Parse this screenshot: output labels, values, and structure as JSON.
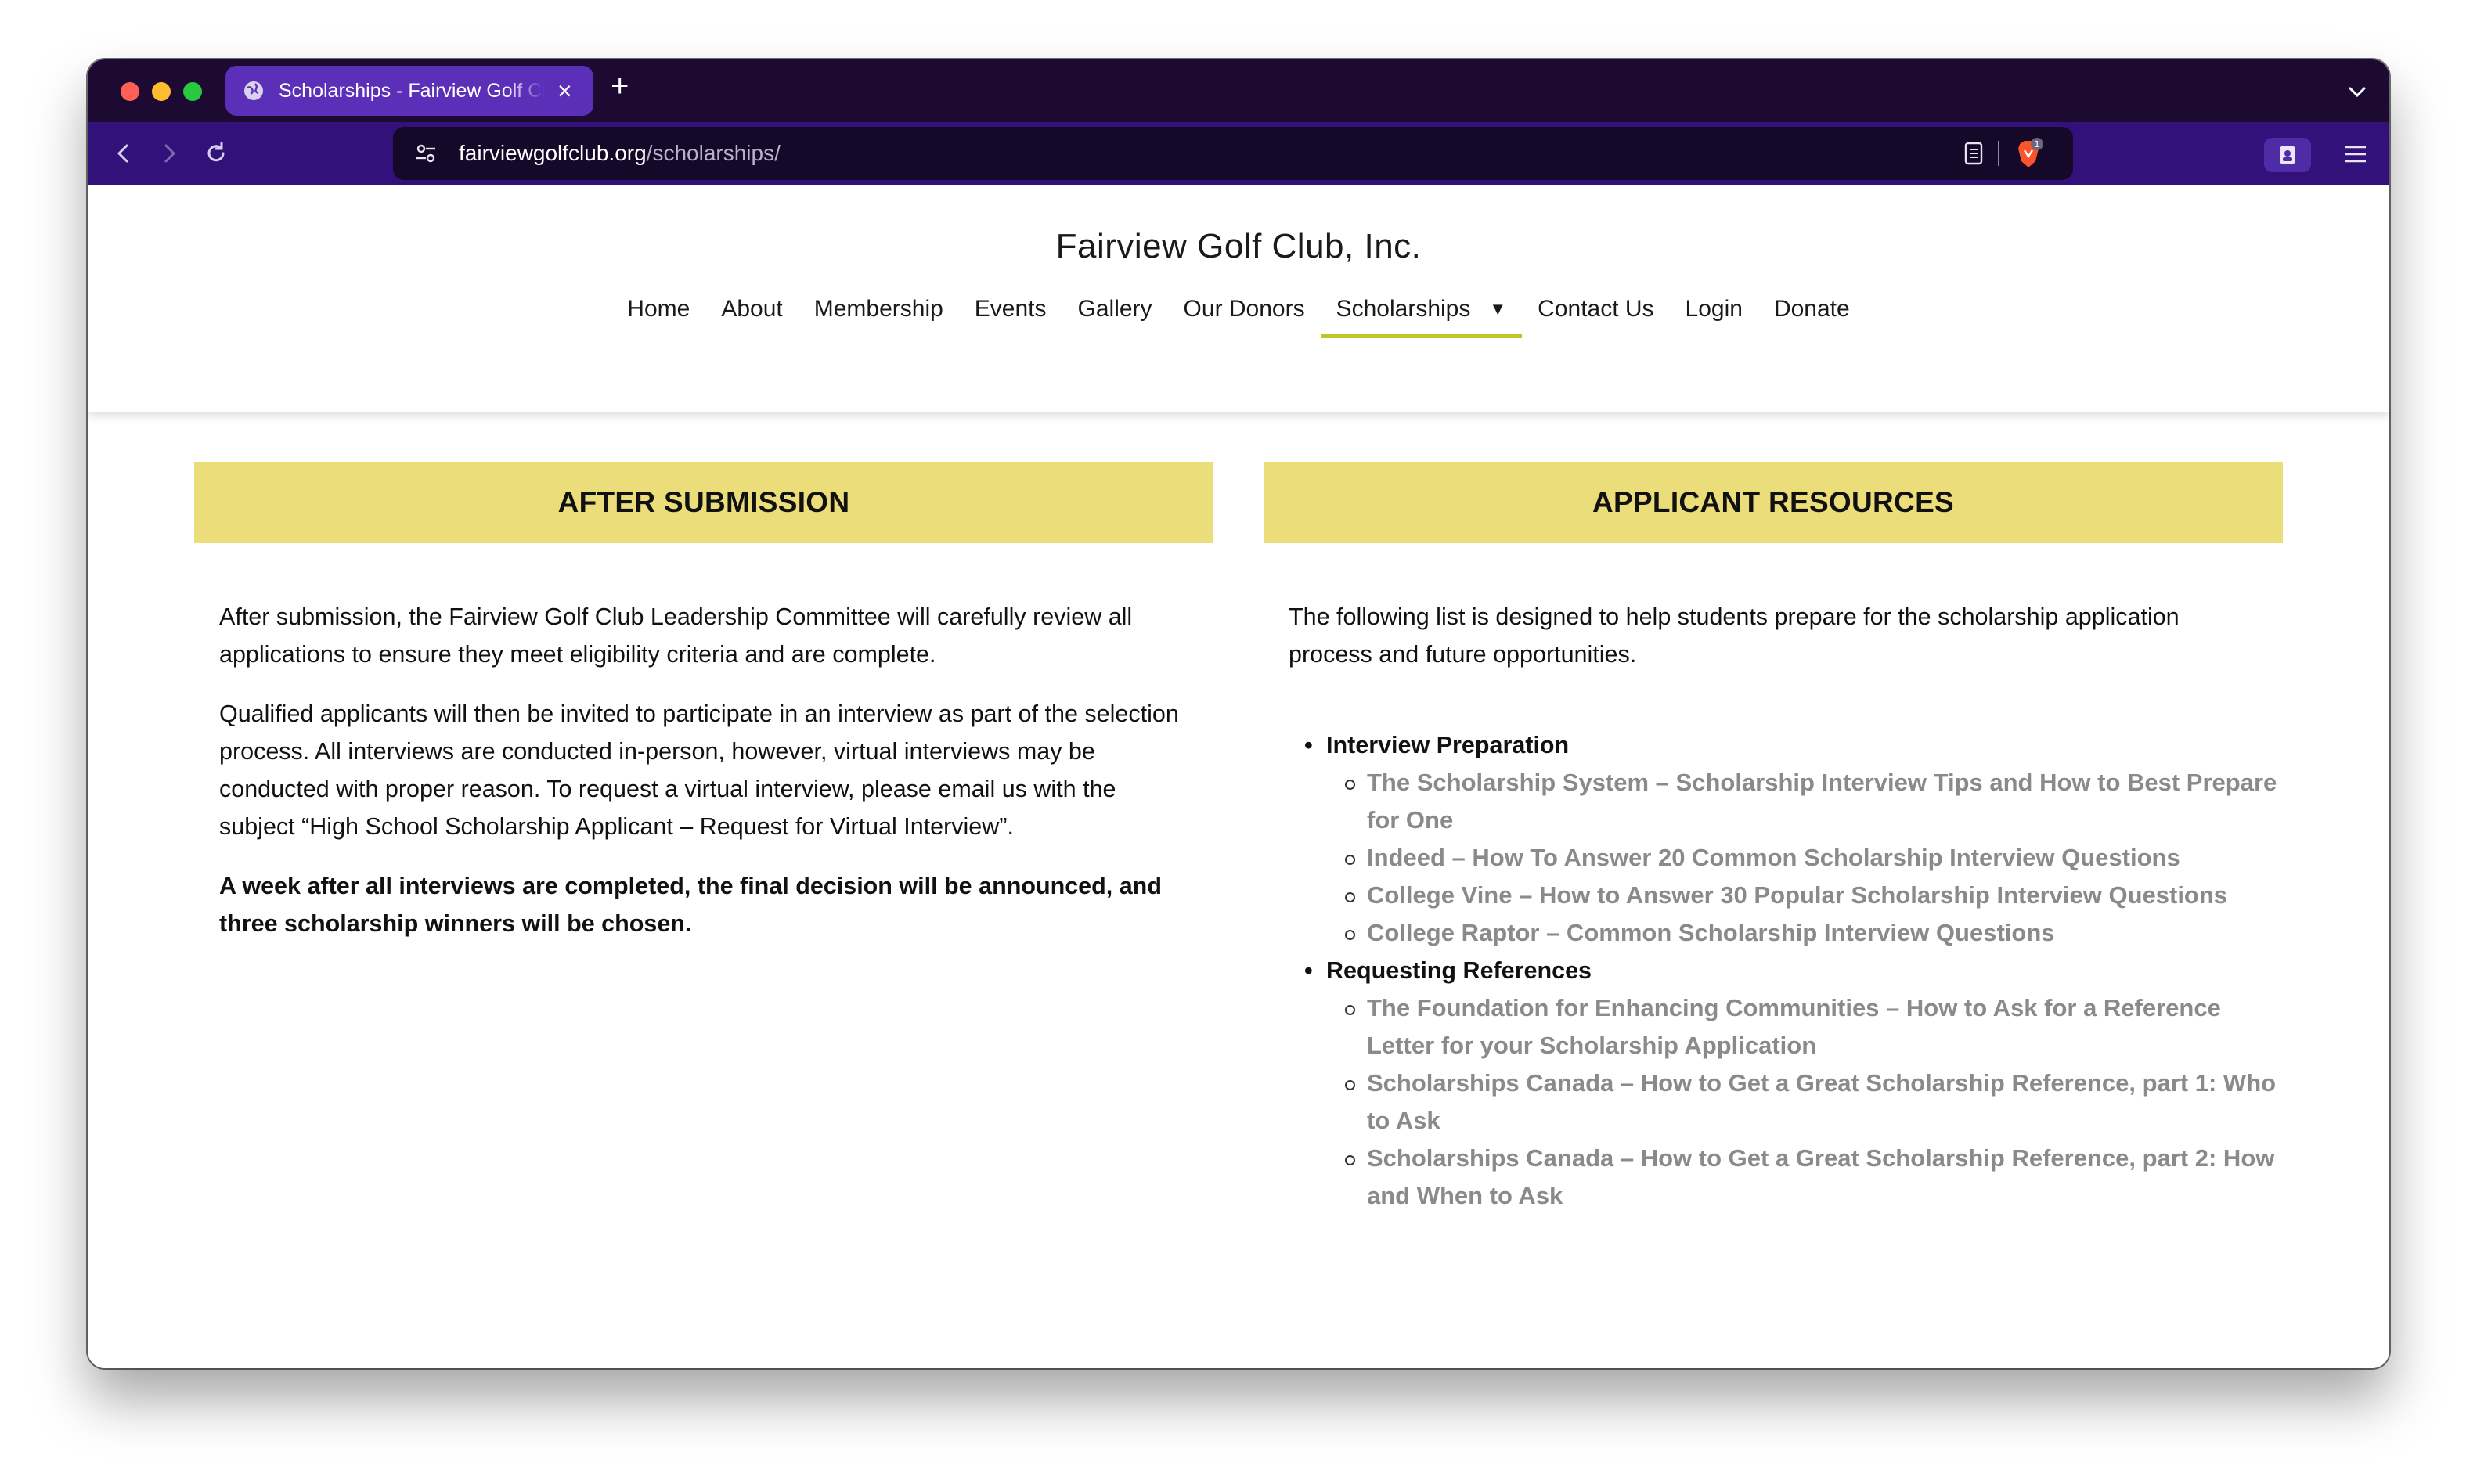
{
  "browser": {
    "tab_title": "Scholarships - Fairview Golf Club, Inc.",
    "url_host": "fairviewgolfclub.org",
    "url_path": "/scholarships/",
    "brave_badge": "1",
    "colors": {
      "tabstrip": "#1c0a33",
      "toolbar": "#32127a",
      "tab_active": "#5b2fb8"
    }
  },
  "site": {
    "title": "Fairview Golf Club, Inc.",
    "nav": [
      {
        "label": "Home"
      },
      {
        "label": "About"
      },
      {
        "label": "Membership"
      },
      {
        "label": "Events"
      },
      {
        "label": "Gallery"
      },
      {
        "label": "Our Donors"
      },
      {
        "label": "Scholarships",
        "active": true
      },
      {
        "label": "Contact Us"
      },
      {
        "label": "Login"
      },
      {
        "label": "Donate"
      }
    ],
    "accent_color": "#c3c22a",
    "banner_color": "#ebdd7a"
  },
  "after_submission": {
    "heading": "AFTER SUBMISSION",
    "p1": "After submission, the Fairview Golf Club Leadership Committee will carefully review all applications to ensure they meet eligibility criteria and are complete.",
    "p2": "Qualified applicants will then be invited to participate in an interview as part of the selection process. All interviews are conducted in-person, however, virtual interviews may be conducted with proper reason. To request a virtual interview, please email us with the subject “High School Scholarship Applicant – Request for Virtual Interview”.",
    "p3": "A week after all interviews are completed, the final decision will be announced, and three scholarship winners will be chosen."
  },
  "applicant_resources": {
    "heading": "APPLICANT RESOURCES",
    "intro": "The following list is designed to help students prepare for the scholarship application process and future opportunities.",
    "categories": [
      {
        "label": "Interview Preparation",
        "links": [
          "The Scholarship System – Scholarship Interview Tips and How to Best Prepare for One",
          "Indeed – How To Answer 20 Common Scholarship Interview Questions",
          "College Vine – How to Answer 30 Popular Scholarship Interview Questions",
          "College Raptor – Common Scholarship Interview Questions"
        ]
      },
      {
        "label": "Requesting References",
        "links": [
          "The Foundation for Enhancing Communities – How to Ask for a Reference Letter for your Scholarship Application",
          "Scholarships Canada – How to Get a Great Scholarship Reference, part 1: Who to Ask",
          "Scholarships Canada – How to Get a Great Scholarship Reference, part 2: How and When to Ask"
        ]
      }
    ]
  }
}
